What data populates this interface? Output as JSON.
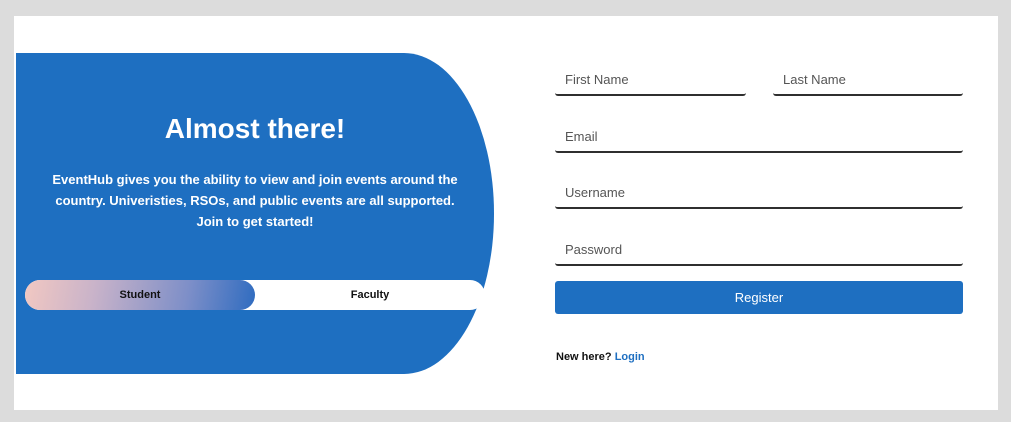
{
  "hero": {
    "title": "Almost there!",
    "description": "EventHub gives you the ability to view and join events around the country. Univeristies, RSOs, and public events are all supported. Join to get started!",
    "roles": [
      {
        "label": "Student",
        "selected": true
      },
      {
        "label": "Faculty",
        "selected": false
      }
    ]
  },
  "form": {
    "first_name": {
      "placeholder": "First Name",
      "value": ""
    },
    "last_name": {
      "placeholder": "Last Name",
      "value": ""
    },
    "email": {
      "placeholder": "Email",
      "value": ""
    },
    "username": {
      "placeholder": "Username",
      "value": ""
    },
    "password": {
      "placeholder": "Password",
      "value": ""
    },
    "register_label": "Register",
    "login_prompt": "New here?",
    "login_link": "Login"
  },
  "colors": {
    "primary": "#1e6fc1",
    "background": "#dcdcdc",
    "card": "#ffffff"
  }
}
